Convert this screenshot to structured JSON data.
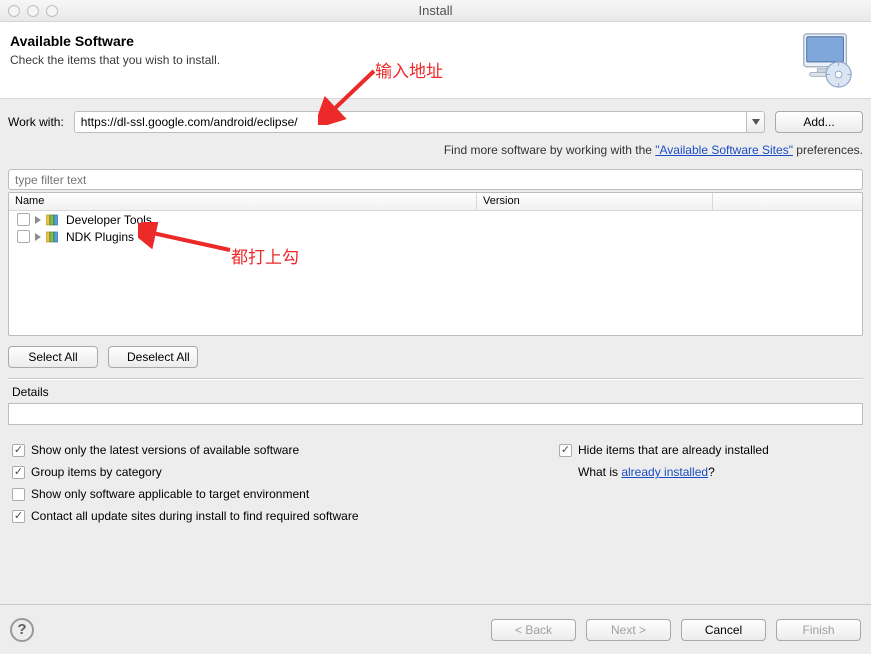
{
  "window": {
    "title": "Install"
  },
  "header": {
    "title": "Available Software",
    "subtitle": "Check the items that you wish to install."
  },
  "annotations": {
    "input_label": "输入地址",
    "check_label": "都打上勾"
  },
  "workwith": {
    "label": "Work with:",
    "value": "https://dl-ssl.google.com/android/eclipse/",
    "add_btn": "Add..."
  },
  "findmore": {
    "prefix": "Find more software by working with the ",
    "link_text": "\"Available Software Sites\"",
    "suffix": " preferences."
  },
  "filter": {
    "placeholder": "type filter text"
  },
  "table": {
    "col_name": "Name",
    "col_version": "Version",
    "rows": [
      {
        "label": "Developer Tools"
      },
      {
        "label": "NDK Plugins"
      }
    ]
  },
  "select_buttons": {
    "all": "Select All",
    "none": "Deselect All"
  },
  "details": {
    "label": "Details"
  },
  "options": {
    "left": [
      {
        "checked": true,
        "label": "Show only the latest versions of available software"
      },
      {
        "checked": true,
        "label": "Group items by category"
      },
      {
        "checked": false,
        "label": "Show only software applicable to target environment"
      },
      {
        "checked": true,
        "label": "Contact all update sites during install to find required software"
      }
    ],
    "right_checked": true,
    "right_label": "Hide items that are already installed",
    "whatis_prefix": "What is ",
    "whatis_link": "already installed",
    "whatis_suffix": "?"
  },
  "nav": {
    "back": "< Back",
    "next": "Next >",
    "cancel": "Cancel",
    "finish": "Finish"
  }
}
